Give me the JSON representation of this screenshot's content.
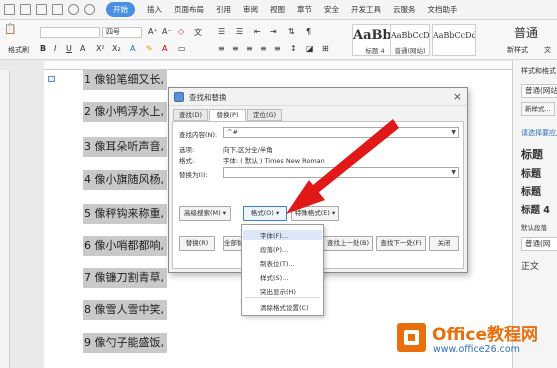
{
  "menubar": {
    "tabs": [
      "开始",
      "插入",
      "页面布局",
      "引用",
      "审阅",
      "视图",
      "章节",
      "安全",
      "开发工具",
      "云服务",
      "文档助手"
    ],
    "active_tab": "开始"
  },
  "ribbon": {
    "font_size": "四号",
    "paste_label": "格式刷",
    "style_cards": [
      {
        "sample": "AaBbC",
        "caption": "标题 4"
      },
      {
        "sample": "AaBbCcD",
        "caption": "普通(网站)"
      },
      {
        "sample": "AaBbCcDd",
        "caption": ""
      }
    ],
    "side_labels": [
      "普通",
      "新样式",
      "文"
    ]
  },
  "document": {
    "lines": [
      "1 像铅笔细又长,",
      "2 像小鸭浮水上,",
      "3 像耳朵听声音,",
      "4 像小旗随风杨,",
      "5 像秤钩来称重,",
      "6 像小哨都都响,",
      "7 像镰刀割青草,",
      "8 像雪人雪中笑,",
      "9 像勺子能盛饭,"
    ]
  },
  "right_pane": {
    "header": "样式和格式",
    "current_style": "普通(网站)",
    "new_style_button": "新样式...",
    "apply_prompt": "请选择要应用的格式",
    "styles": [
      "标题",
      "标题",
      "标题",
      "标题 4",
      "默认段落",
      "普通(网",
      "正文"
    ]
  },
  "dialog": {
    "title": "查找和替换",
    "tabs": [
      "查找(D)",
      "替换(P)",
      "定位(G)"
    ],
    "active_tab": "替换(P)",
    "find_label": "查找内容(N):",
    "find_value": "^#",
    "options_label": "选项:",
    "options_value": "向下,区分全/半角",
    "format_label": "格式:",
    "format_value": "字体: ( 默认 ) Times New Roman",
    "replace_label": "替换为(I):",
    "replace_value": "",
    "btn_advanced": "高级搜索(M)",
    "btn_format": "格式(O)",
    "btn_special": "特殊格式(E)",
    "btn_replace": "替换(R)",
    "btn_replace_all": "全部替换(A)",
    "btn_find_prev": "查找上一处(B)",
    "btn_find_next": "查找下一处(F)",
    "btn_close": "关闭"
  },
  "format_menu": {
    "items": [
      "字体(F)...",
      "段落(P)...",
      "制表位(T)...",
      "样式(S)...",
      "突出显示(H)",
      "清除格式设置(C)"
    ],
    "highlighted": "字体(F)..."
  },
  "watermark": {
    "brand": "Office教程网",
    "url": "www.office26.com"
  },
  "colors": {
    "accent": "#4a90e2",
    "arrow": "#e01818",
    "brand_orange": "#e8700c",
    "brand_blue": "#2c6fb8"
  }
}
